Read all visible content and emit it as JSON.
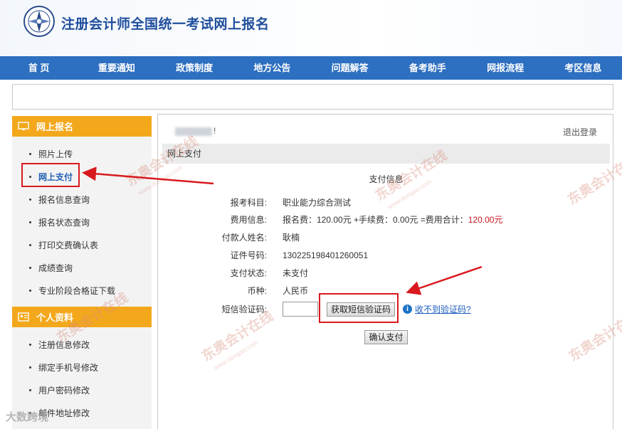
{
  "header": {
    "title": "注册会计师全国统一考试网上报名"
  },
  "nav": [
    "首 页",
    "重要通知",
    "政策制度",
    "地方公告",
    "问题解答",
    "备考助手",
    "网报流程",
    "考区信息"
  ],
  "sidebar": {
    "section1": {
      "title": "网上报名",
      "items": [
        {
          "label": "照片上传"
        },
        {
          "label": "网上支付",
          "active": true
        },
        {
          "label": "报名信息查询"
        },
        {
          "label": "报名状态查询"
        },
        {
          "label": "打印交费确认表"
        },
        {
          "label": "成绩查询"
        },
        {
          "label": "专业阶段合格证下载"
        }
      ]
    },
    "section2": {
      "title": "个人资料",
      "items": [
        {
          "label": "注册信息修改"
        },
        {
          "label": "绑定手机号修改"
        },
        {
          "label": "用户密码修改"
        },
        {
          "label": "邮件地址修改"
        }
      ]
    }
  },
  "main": {
    "welcome_suffix": "!",
    "logout": "退出登录",
    "section_title": "网上支付",
    "form_title": "支付信息",
    "rows": {
      "subject": {
        "label": "报考科目:",
        "value": "职业能力综合测试"
      },
      "fee": {
        "label": "费用信息:",
        "value_prefix": "报名费：120.00元 +手续费：0.00元 =费用合计：",
        "value_total": "120.00元"
      },
      "payer": {
        "label": "付款人姓名:",
        "value": "耿楠"
      },
      "id": {
        "label": "证件号码:",
        "value": "130225198401260051"
      },
      "status": {
        "label": "支付状态:",
        "value": "未支付"
      },
      "currency": {
        "label": "币种:",
        "value": "人民币"
      },
      "sms": {
        "label": "短信验证码:"
      }
    },
    "get_sms_button": "获取短信验证码",
    "help_link": "收不到验证码?",
    "confirm_button": "确认支付"
  },
  "watermark": {
    "text": "东奥会计在线",
    "sub": "www.dongao.com"
  },
  "corner_watermark": "大数跨境",
  "colors": {
    "nav": "#2d6fc0",
    "title": "#1f4e9c",
    "sidebar_head": "#f3a81c",
    "annotation": "#d9191e",
    "alert": "#c8161d"
  }
}
